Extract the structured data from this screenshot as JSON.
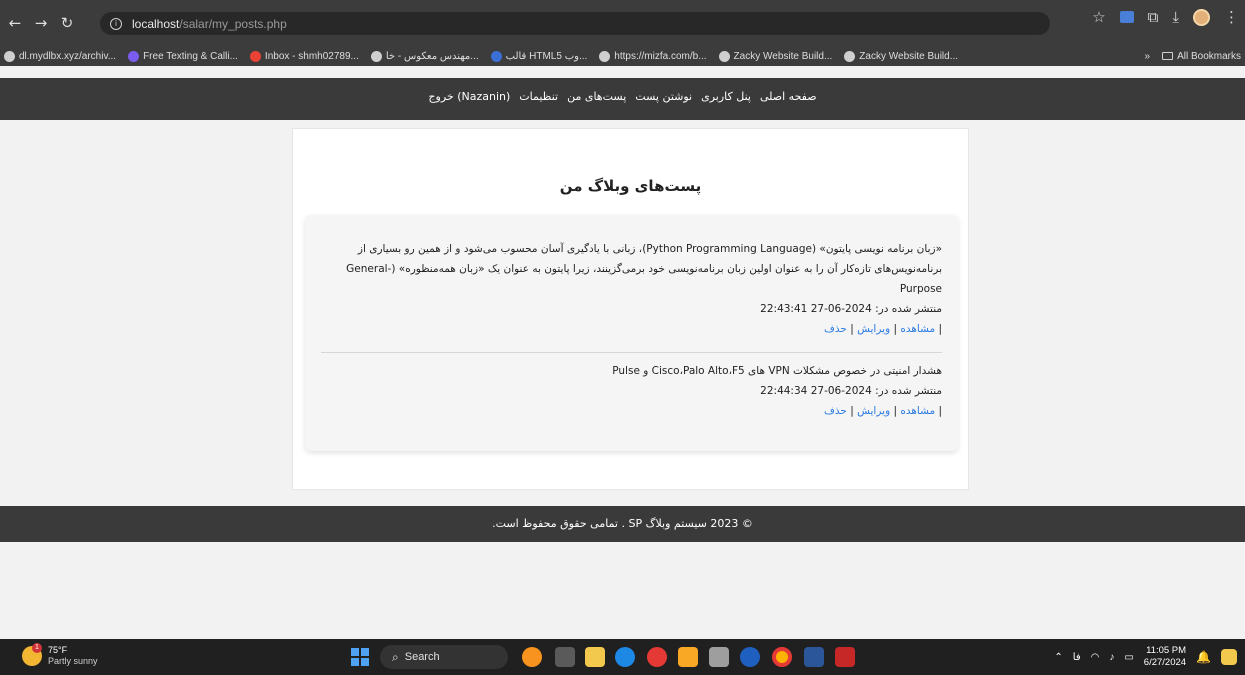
{
  "browser": {
    "url_host": "localhost",
    "url_path": "/salar/my_posts.php",
    "bookmarks": [
      {
        "label": "dl.mydlbx.xyz/archiv...",
        "icon": "globe-icon",
        "color": "#cfcfcf"
      },
      {
        "label": "Free Texting & Calli...",
        "icon": "texting-icon",
        "color": "#7b5cf0"
      },
      {
        "label": "Inbox - shmh02789...",
        "icon": "gmail-icon",
        "color": "#ea4335"
      },
      {
        "label": "مهندس معکوس - خا...",
        "icon": "globe-icon",
        "color": "#cfcfcf"
      },
      {
        "label": "قالب HTML5 وب...",
        "icon": "code-icon",
        "color": "#3b6fd8"
      },
      {
        "label": "https://mizfa.com/b...",
        "icon": "globe-icon",
        "color": "#cfcfcf"
      },
      {
        "label": "Zacky Website Build...",
        "icon": "zacky-icon",
        "color": "#cfcfcf"
      },
      {
        "label": "Zacky Website Build...",
        "icon": "zacky-icon",
        "color": "#cfcfcf"
      }
    ],
    "more_label": "»",
    "all_bookmarks_label": "All Bookmarks"
  },
  "site": {
    "nav": [
      "صفحه اصلی",
      "پنل کاربری",
      "نوشتن پست",
      "پست‌های من",
      "تنظیمات",
      "(Nazanin) خروج"
    ],
    "page_title": "پست‌های وبلاگ من",
    "posts": [
      {
        "content": "«زبان برنامه نویسی پایتون» (Python Programming Language)، زبانی با یادگیری آسان محسوب می‌شود و از همین رو بسیاری از برنامه‌نویس‌های تازه‌کار آن را به عنوان اولین زبان برنامه‌نویسی خود برمی‌گزینند، زیرا پایتون به عنوان یک «زبان همه‌منظوره» (General-Purpose",
        "published": "منتشر شده در: 2024-06-27 22:43:41",
        "view": "مشاهده",
        "edit": "ویرایش",
        "delete": "حذف"
      },
      {
        "content": "هشدار امنیتی در خصوص مشکلات VPN های Cisco،Palo Alto،F5 و Pulse",
        "published": "منتشر شده در: 2024-06-27 22:44:34",
        "view": "مشاهده",
        "edit": "ویرایش",
        "delete": "حذف"
      }
    ],
    "footer": "© 2023 سیستم وبلاگ SP . تمامی حقوق محفوظ است."
  },
  "taskbar": {
    "weather_temp": "75°F",
    "weather_desc": "Partly sunny",
    "weather_badge": "1",
    "search_label": "Search",
    "language": "فا",
    "time": "11:05 PM",
    "date": "6/27/2024"
  },
  "colors": {
    "header_bg": "#3a3a3a",
    "link": "#2a7ae2",
    "page_bg": "#f2f2f2"
  }
}
